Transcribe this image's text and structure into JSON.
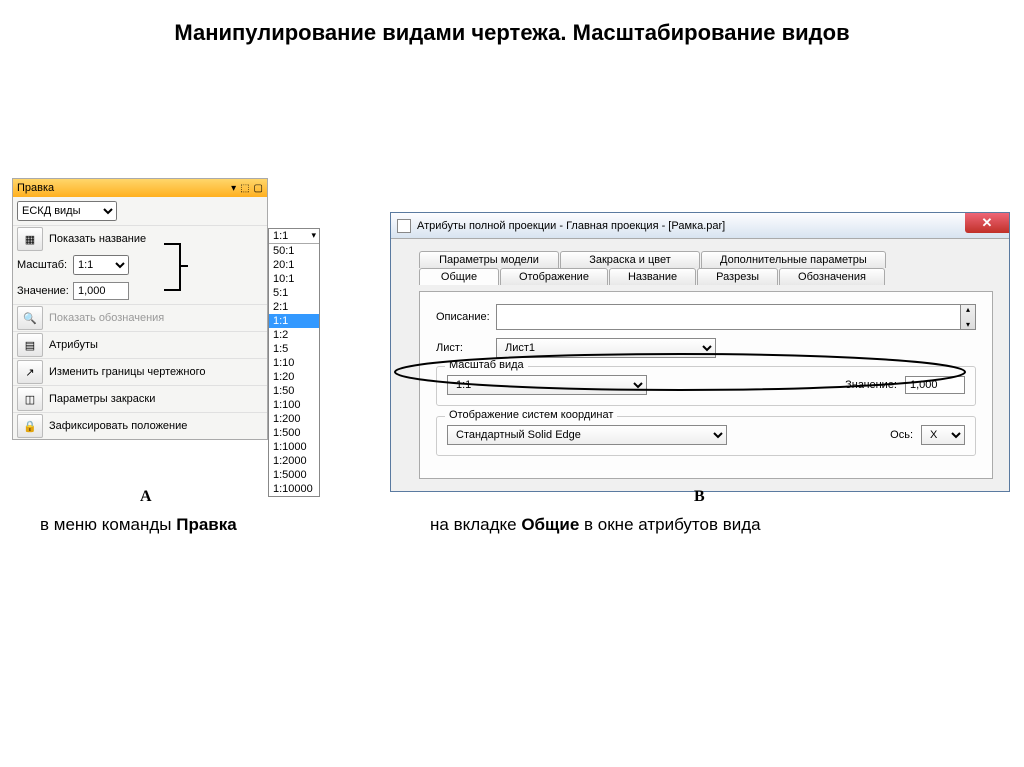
{
  "page_title": "Манипулирование видами чертежа. Масштабирование видов",
  "panel_a": {
    "header": "Правка",
    "toolbar_select": "ЕСКД виды",
    "row_show_name": "Показать название",
    "scale_label": "Масштаб:",
    "scale_value": "1:1",
    "value_label": "Значение:",
    "value_input": "1,000",
    "row_show_designation": "Показать обозначения",
    "row_attributes": "Атрибуты",
    "row_change_bounds": "Изменить границы чертежного",
    "row_shading_params": "Параметры закраски",
    "row_lock_position": "Зафиксировать положение"
  },
  "scale_list": {
    "header": "1:1",
    "items": [
      "50:1",
      "20:1",
      "10:1",
      "5:1",
      "2:1",
      "1:1",
      "1:2",
      "1:5",
      "1:10",
      "1:20",
      "1:50",
      "1:100",
      "1:200",
      "1:500",
      "1:1000",
      "1:2000",
      "1:5000",
      "1:10000"
    ],
    "selected": "1:1"
  },
  "panel_b": {
    "title": "Атрибуты полной проекции - Главная проекция - [Рамка.par]",
    "close_glyph": "✕",
    "tabs_row1": [
      "Параметры модели",
      "Закраска и цвет",
      "Дополнительные параметры"
    ],
    "tabs_row2": [
      "Общие",
      "Отображение",
      "Название",
      "Разрезы",
      "Обозначения"
    ],
    "active_tab": "Общие",
    "desc_label": "Описание:",
    "sheet_label": "Лист:",
    "sheet_value": "Лист1",
    "scale_group": "Масштаб вида",
    "scale_value": "1:1",
    "value_label": "Значение:",
    "value_input": "1,000",
    "coord_group": "Отображение систем координат",
    "coord_value": "Стандартный Solid Edge",
    "axis_label": "Ось:",
    "axis_value": "X"
  },
  "captions": {
    "a": "А",
    "b": "В",
    "a_prefix": "в меню команды ",
    "a_bold": "Правка",
    "b_prefix": "на вкладке ",
    "b_bold": "Общие",
    "b_suffix": " в окне атрибутов вида"
  }
}
